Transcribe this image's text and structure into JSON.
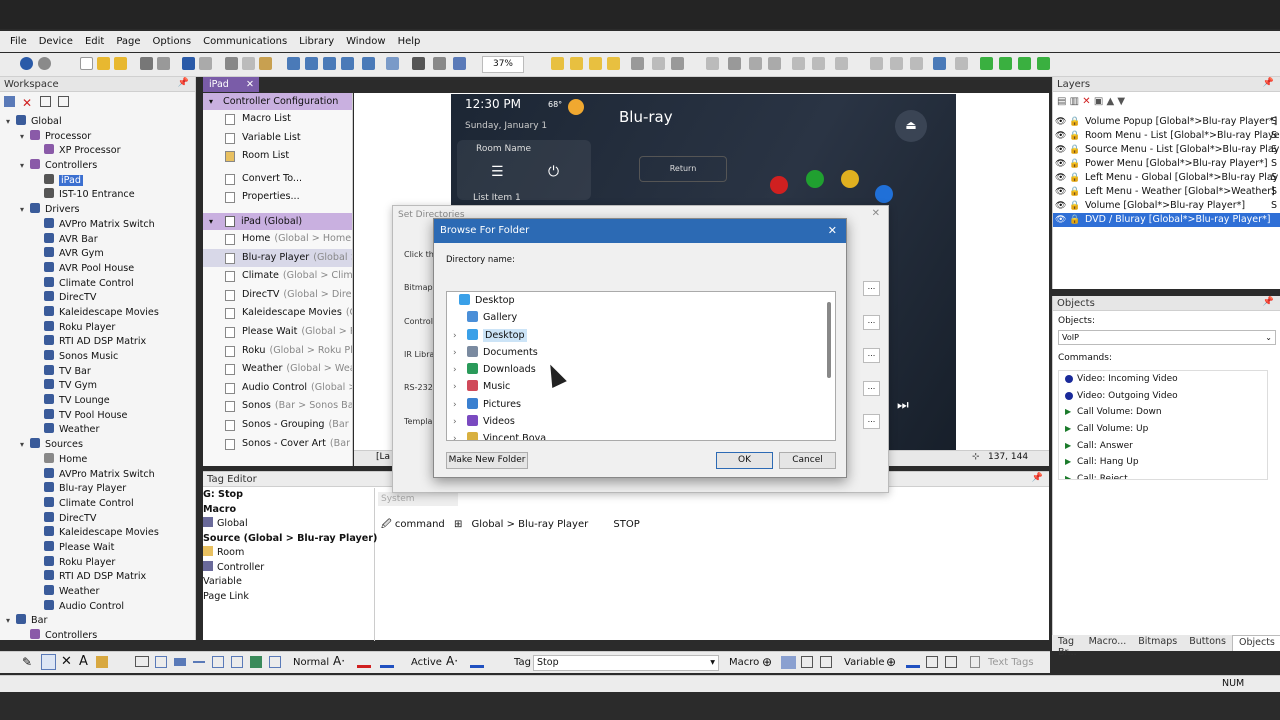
{
  "menu": [
    "File",
    "Device",
    "Edit",
    "Page",
    "Options",
    "Communications",
    "Library",
    "Window",
    "Help"
  ],
  "zoom": "37%",
  "workspace": {
    "title": "Workspace",
    "tree": [
      {
        "label": "Global",
        "level": 0,
        "arrow": "▾",
        "color": "#3a5b9a"
      },
      {
        "label": "Processor",
        "level": 1,
        "arrow": "▾",
        "color": "#8a5aa8"
      },
      {
        "label": "XP Processor",
        "level": 2,
        "arrow": "",
        "color": "#8a5aa8"
      },
      {
        "label": "Controllers",
        "level": 1,
        "arrow": "▾",
        "color": "#8a5aa8"
      },
      {
        "label": "iPad",
        "level": 2,
        "arrow": "",
        "color": "#555",
        "selected": true
      },
      {
        "label": "IST-10 Entrance",
        "level": 2,
        "arrow": "",
        "color": "#555"
      },
      {
        "label": "Drivers",
        "level": 1,
        "arrow": "▾",
        "color": "#3a5b9a"
      },
      {
        "label": "AVPro Matrix Switch",
        "level": 2,
        "arrow": "",
        "color": "#3a5b9a"
      },
      {
        "label": "AVR Bar",
        "level": 2,
        "arrow": "",
        "color": "#3a5b9a"
      },
      {
        "label": "AVR Gym",
        "level": 2,
        "arrow": "",
        "color": "#3a5b9a"
      },
      {
        "label": "AVR Pool House",
        "level": 2,
        "arrow": "",
        "color": "#3a5b9a"
      },
      {
        "label": "Climate Control",
        "level": 2,
        "arrow": "",
        "color": "#3a5b9a"
      },
      {
        "label": "DirecTV",
        "level": 2,
        "arrow": "",
        "color": "#3a5b9a"
      },
      {
        "label": "Kaleidescape Movies",
        "level": 2,
        "arrow": "",
        "color": "#3a5b9a"
      },
      {
        "label": "Roku Player",
        "level": 2,
        "arrow": "",
        "color": "#3a5b9a"
      },
      {
        "label": "RTI AD DSP Matrix",
        "level": 2,
        "arrow": "",
        "color": "#3a5b9a"
      },
      {
        "label": "Sonos Music",
        "level": 2,
        "arrow": "",
        "color": "#3a5b9a"
      },
      {
        "label": "TV Bar",
        "level": 2,
        "arrow": "",
        "color": "#3a5b9a"
      },
      {
        "label": "TV Gym",
        "level": 2,
        "arrow": "",
        "color": "#3a5b9a"
      },
      {
        "label": "TV Lounge",
        "level": 2,
        "arrow": "",
        "color": "#3a5b9a"
      },
      {
        "label": "TV Pool House",
        "level": 2,
        "arrow": "",
        "color": "#3a5b9a"
      },
      {
        "label": "Weather",
        "level": 2,
        "arrow": "",
        "color": "#3a5b9a"
      },
      {
        "label": "Sources",
        "level": 1,
        "arrow": "▾",
        "color": "#3a5b9a"
      },
      {
        "label": "Home",
        "level": 2,
        "arrow": "",
        "color": "#888"
      },
      {
        "label": "AVPro Matrix Switch",
        "level": 2,
        "arrow": "",
        "color": "#3a5b9a"
      },
      {
        "label": "Blu-ray Player",
        "level": 2,
        "arrow": "",
        "color": "#3a5b9a"
      },
      {
        "label": "Climate Control",
        "level": 2,
        "arrow": "",
        "color": "#3a5b9a"
      },
      {
        "label": "DirecTV",
        "level": 2,
        "arrow": "",
        "color": "#3a5b9a"
      },
      {
        "label": "Kaleidescape Movies",
        "level": 2,
        "arrow": "",
        "color": "#3a5b9a"
      },
      {
        "label": "Please Wait",
        "level": 2,
        "arrow": "",
        "color": "#3a5b9a"
      },
      {
        "label": "Roku Player",
        "level": 2,
        "arrow": "",
        "color": "#3a5b9a"
      },
      {
        "label": "RTI AD DSP Matrix",
        "level": 2,
        "arrow": "",
        "color": "#3a5b9a"
      },
      {
        "label": "Weather",
        "level": 2,
        "arrow": "",
        "color": "#3a5b9a"
      },
      {
        "label": "Audio Control",
        "level": 2,
        "arrow": "",
        "color": "#3a5b9a"
      },
      {
        "label": "Bar",
        "level": 0,
        "arrow": "▾",
        "color": "#3a5b9a"
      },
      {
        "label": "Controllers",
        "level": 1,
        "arrow": "",
        "color": "#8a5aa8"
      }
    ]
  },
  "doc_tab": "iPad",
  "controller": {
    "header": "Controller Configuration",
    "items": [
      "Macro List",
      "Variable List",
      "Room List",
      "Convert To...",
      "Properties..."
    ],
    "pages_header": "iPad (Global)",
    "pages": [
      {
        "name": "Home",
        "sub": "(Global > Home)"
      },
      {
        "name": "Blu-ray Player",
        "sub": "(Global >",
        "selected": true
      },
      {
        "name": "Climate",
        "sub": "(Global > Climat"
      },
      {
        "name": "DirecTV",
        "sub": "(Global > DirecT"
      },
      {
        "name": "Kaleidescape Movies",
        "sub": "(Gl"
      },
      {
        "name": "Please Wait",
        "sub": "(Global > Ple"
      },
      {
        "name": "Roku",
        "sub": "(Global > Roku Pla"
      },
      {
        "name": "Weather",
        "sub": "(Global > Weat"
      },
      {
        "name": "Audio Control",
        "sub": "(Global >"
      },
      {
        "name": "Sonos",
        "sub": "(Bar > Sonos Bar)"
      },
      {
        "name": "Sonos - Grouping",
        "sub": "(Bar >"
      },
      {
        "name": "Sonos - Cover Art",
        "sub": "(Bar >"
      }
    ]
  },
  "ipad": {
    "time": "12:30 PM",
    "temp": "68°",
    "date": "Sunday, January 1",
    "room": "Room Name",
    "title": "Blu-ray",
    "return": "Return",
    "list": "List Item 1"
  },
  "canvas": {
    "coords": "137, 144",
    "left_fragment": "[La"
  },
  "set_dir": {
    "title": "Set Directories",
    "labels": [
      "Click th",
      "Bitmap",
      "Control",
      "IR Libra",
      "RS-232",
      "Templa"
    ]
  },
  "browse": {
    "title": "Browse For Folder",
    "dir_label": "Directory name:",
    "folders": [
      {
        "label": "Desktop",
        "level": 0,
        "color": "#3aa0e8",
        "arrow": ""
      },
      {
        "label": "Gallery",
        "level": 1,
        "color": "#4a8fd8",
        "arrow": ""
      },
      {
        "label": "Desktop",
        "level": 1,
        "color": "#3aa0e8",
        "arrow": "›",
        "selected": true
      },
      {
        "label": "Documents",
        "level": 1,
        "color": "#7a8aa0",
        "arrow": "›"
      },
      {
        "label": "Downloads",
        "level": 1,
        "color": "#2a9a5a",
        "arrow": "›"
      },
      {
        "label": "Music",
        "level": 1,
        "color": "#d04a5a",
        "arrow": "›"
      },
      {
        "label": "Pictures",
        "level": 1,
        "color": "#3a80d0",
        "arrow": "›"
      },
      {
        "label": "Videos",
        "level": 1,
        "color": "#7a4ac0",
        "arrow": "›"
      },
      {
        "label": "Vincent Boya",
        "level": 1,
        "color": "#d8b040",
        "arrow": "›"
      }
    ],
    "new_folder": "Make New Folder",
    "ok": "OK",
    "cancel": "Cancel"
  },
  "tag_editor": {
    "title": "Tag Editor",
    "items": [
      {
        "label": "G: Stop",
        "bold": true
      },
      {
        "label": "Macro",
        "bold": true
      },
      {
        "label": "Global",
        "bold": false,
        "icon": true
      },
      {
        "label": "Source (Global > Blu-ray Player)",
        "bold": true
      },
      {
        "label": "Room",
        "bold": false,
        "icon": true
      },
      {
        "label": "Controller",
        "bold": false,
        "icon": true
      },
      {
        "label": "Variable",
        "bold": false
      },
      {
        "label": "Page Link",
        "bold": false
      }
    ],
    "system": "System",
    "cmd": "command",
    "path": "Global > Blu-ray Player",
    "value": "STOP"
  },
  "layers": {
    "title": "Layers",
    "items": [
      {
        "label": "Volume Popup [Global*>Blu-ray Player*]",
        "suffix": "S"
      },
      {
        "label": "Room Menu - List [Global*>Blu-ray Playe",
        "suffix": "S"
      },
      {
        "label": "Source Menu - List [Global*>Blu-ray Play",
        "suffix": "S"
      },
      {
        "label": "Power Menu [Global*>Blu-ray Player*]",
        "suffix": "S"
      },
      {
        "label": "Left Menu - Global [Global*>Blu-ray Play",
        "suffix": "S"
      },
      {
        "label": "Left Menu - Weather [Global*>Weather]",
        "suffix": "S"
      },
      {
        "label": "Volume [Global*>Blu-ray Player*]",
        "suffix": "S"
      },
      {
        "label": "DVD / Bluray [Global*>Blu-ray Player*]",
        "suffix": "",
        "selected": true
      }
    ]
  },
  "objects": {
    "title": "Objects",
    "objects_label": "Objects:",
    "select_value": "VoIP",
    "commands_label": "Commands:",
    "commands": [
      {
        "label": "Video: Incoming Video",
        "type": "dot"
      },
      {
        "label": "Video: Outgoing Video",
        "type": "dot"
      },
      {
        "label": "Call Volume: Down",
        "type": "tri"
      },
      {
        "label": "Call Volume: Up",
        "type": "tri"
      },
      {
        "label": "Call: Answer",
        "type": "tri"
      },
      {
        "label": "Call: Hang Up",
        "type": "tri"
      },
      {
        "label": "Call: Reject",
        "type": "tri"
      }
    ]
  },
  "right_tabs": [
    "Tag Br...",
    "Macro...",
    "Bitmaps",
    "Buttons",
    "Objects"
  ],
  "prop": {
    "normal": "Normal",
    "active": "Active",
    "tag_label": "Tag",
    "tag_value": "Stop",
    "macro": "Macro",
    "variable": "Variable",
    "text_tags": "Text Tags"
  },
  "status": {
    "num": "NUM"
  }
}
